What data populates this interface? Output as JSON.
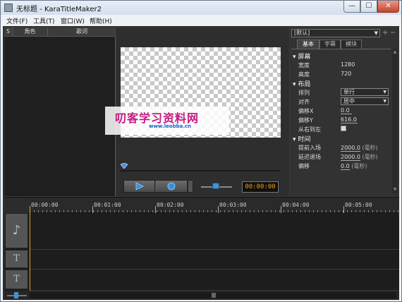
{
  "window": {
    "title": "无标题 - KaraTitleMaker2",
    "min_glyph": "—",
    "max_glyph": "☐",
    "close_glyph": "✕"
  },
  "menu": [
    "文件(F)",
    "工具(T)",
    "窗口(W)",
    "帮助(H)"
  ],
  "lyrics_table": {
    "columns": [
      "S",
      "角色",
      "歌词"
    ],
    "rows": []
  },
  "preview": {
    "watermark_main": "叨客学习资料网",
    "watermark_url": "www.leobba.cn",
    "time": "00:00:00",
    "icons": [
      "play-icon",
      "record-icon"
    ]
  },
  "properties": {
    "preset": "[默认]",
    "preset_add": "+",
    "preset_del": "−",
    "tabs": [
      "基本",
      "字幕",
      "模块"
    ],
    "active_tab": "基本",
    "sections": {
      "screen": {
        "title": "屏幕",
        "width_label": "宽度",
        "width_value": "1280",
        "height_label": "高度",
        "height_value": "720"
      },
      "layout": {
        "title": "布局",
        "arrange_label": "排列",
        "arrange_value": "单行",
        "align_label": "对齐",
        "align_value": "居中",
        "offset_x_label": "偏移X",
        "offset_x_value": "0.0",
        "offset_y_label": "偏移Y",
        "offset_y_value": "616.0",
        "rtl_label": "从右到左",
        "rtl_checked": false
      },
      "time": {
        "title": "时间",
        "pre_label": "提前入场",
        "pre_value": "2000.0",
        "pre_unit": "(毫秒)",
        "delay_label": "延迟退场",
        "delay_value": "2000.0",
        "delay_unit": "(毫秒)",
        "shift_label": "偏移",
        "shift_value": "0.0",
        "shift_unit": "(毫秒)"
      }
    }
  },
  "timeline": {
    "ticks": [
      "00:00:00",
      "00:01:00",
      "00:02:00",
      "00:03:00",
      "00:04:00",
      "00:05:00"
    ],
    "track_icons": [
      "music-note-icon",
      "text-track-icon",
      "text-track-icon"
    ],
    "track_glyphs": [
      "♪",
      "T",
      "T"
    ]
  }
}
